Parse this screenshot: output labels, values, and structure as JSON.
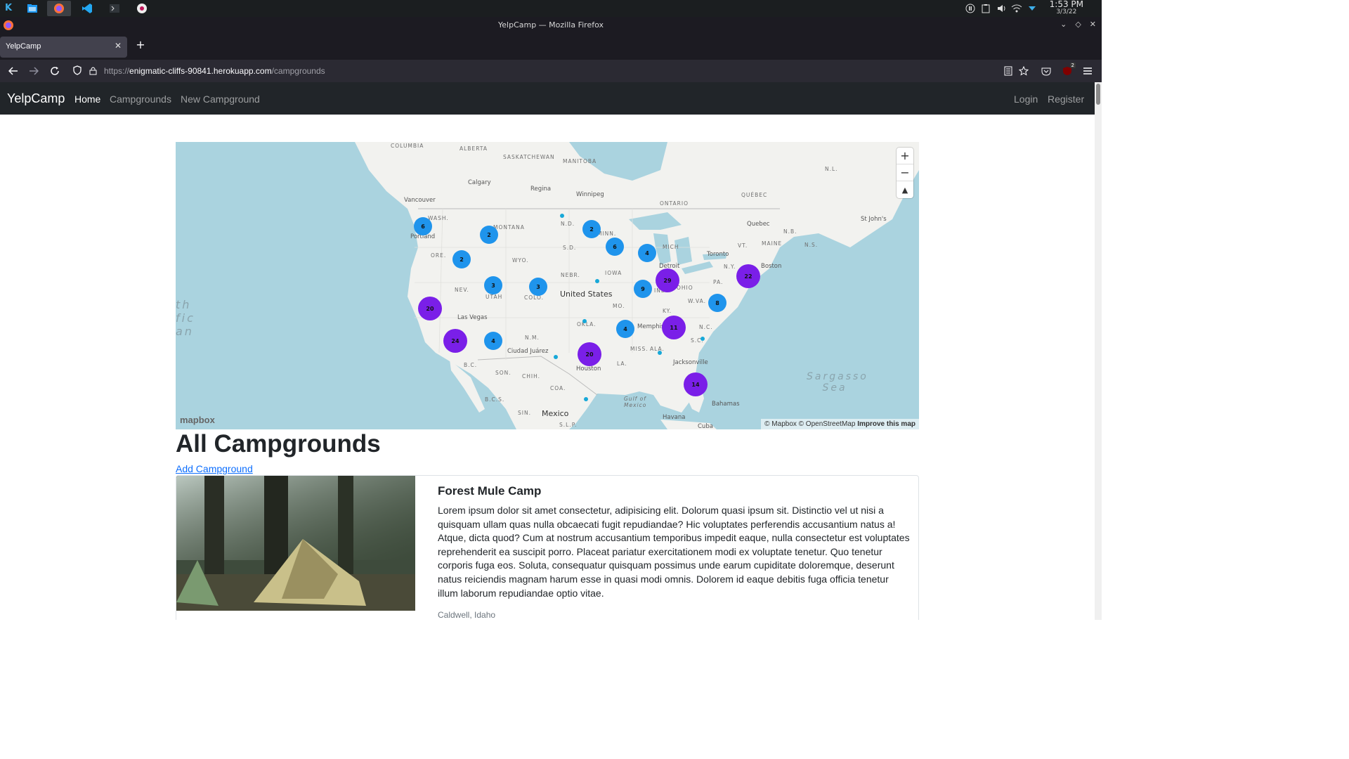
{
  "taskbar": {
    "time": "1:53 PM",
    "date": "3/3/22"
  },
  "browser": {
    "window_title": "YelpCamp — Mozilla Firefox",
    "tab_title": "YelpCamp",
    "url_prefix": "https://",
    "url_host": "enigmatic-cliffs-90841.herokuapp.com",
    "url_path": "/campgrounds",
    "extension_badge": "2"
  },
  "site_nav": {
    "brand": "YelpCamp",
    "links": [
      "Home",
      "Campgrounds",
      "New Campground"
    ],
    "login": "Login",
    "register": "Register"
  },
  "map": {
    "clusters": [
      "6",
      "2",
      "2",
      "6",
      "4",
      "2",
      "3",
      "3",
      "9",
      "29",
      "22",
      "20",
      "8",
      "4",
      "11",
      "24",
      "4",
      "20",
      "14"
    ],
    "labels": {
      "columbia": "COLUMBIA",
      "alberta": "ALBERTA",
      "saskatchewan": "SASKATCHEWAN",
      "manitoba": "MANITOBA",
      "ontario": "ONTARIO",
      "quebec": "QUÉBEC",
      "nl": "N.L.",
      "calgary": "Calgary",
      "regina": "Regina",
      "winnipeg": "Winnipeg",
      "vancouver": "Vancouver",
      "wash": "WASH.",
      "montana": "MONTANA",
      "nd": "N.D.",
      "minn": "MINN.",
      "mich": "MICH",
      "quebec_city": "Quebec",
      "st_johns": "St John's",
      "nb": "N.B.",
      "ns": "N.S.",
      "maine": "MAINE",
      "vt": "VT.",
      "portland": "Portland",
      "ore": "ORE.",
      "sd": "S.D.",
      "wyo": "WYO.",
      "toronto": "Toronto",
      "detroit": "Detroit",
      "ny": "N.Y.",
      "boston": "Boston",
      "iowa": "IOWA",
      "nebr": "NEBR.",
      "pa": "PA.",
      "nev": "NEV.",
      "utah": "UTAH",
      "colo": "COLO.",
      "united_states": "United States",
      "ind": "IND.",
      "ohio": "OHIO",
      "wva": "W.VA.",
      "mo": "MO.",
      "ky": "KY.",
      "las_vegas": "Las Vegas",
      "okla": "OKLA.",
      "memphis": "Memphis",
      "nc": "N.C.",
      "nm": "N.M.",
      "sc": "S.C.",
      "ciudad_juarez": "Ciudad Juárez",
      "houston": "Houston",
      "miss": "MISS.",
      "ala": "ALA.",
      "la": "LA.",
      "jacksonville": "Jacksonville",
      "son": "SON.",
      "chih": "CHIH.",
      "bc": "B.C.",
      "bcs": "B.C.S.",
      "coa": "COA.",
      "gulf_of_mexico": "Gulf of Mexico",
      "mexico": "Mexico",
      "sin": "SIN.",
      "slp": "S.L.P.",
      "havana": "Havana",
      "cuba": "Cuba",
      "bahamas": "Bahamas",
      "sargasso_sea": "Sargasso Sea",
      "ocean_fragment": "th fic an"
    },
    "logo": "mapbox",
    "attribution": "© Mapbox © OpenStreetMap",
    "improve": "Improve this map"
  },
  "main": {
    "heading": "All Campgrounds",
    "add_link": "Add Campground",
    "campgrounds": [
      {
        "title": "Forest Mule Camp",
        "description": "Lorem ipsum dolor sit amet consectetur, adipisicing elit. Dolorum quasi ipsum sit. Distinctio vel ut nisi a quisquam ullam quas nulla obcaecati fugit repudiandae? Hic voluptates perferendis accusantium natus a! Atque, dicta quod? Cum at nostrum accusantium temporibus impedit eaque, nulla consectetur est voluptates reprehenderit ea suscipit porro. Placeat pariatur exercitationem modi ex voluptate tenetur. Quo tenetur corporis fuga eos. Soluta, consequatur quisquam possimus unde earum cupiditate doloremque, deserunt natus reiciendis magnam harum esse in quasi modi omnis. Dolorem id eaque debitis fuga officia tenetur illum laborum repudiandae optio vitae.",
        "location": "Caldwell, Idaho"
      }
    ]
  },
  "colors": {
    "navbar_bg": "#212529",
    "cluster_blue": "#1f94ec",
    "cluster_purple": "#7a1fe8",
    "point_cyan": "#17a8d8",
    "link": "#0d6efd"
  }
}
